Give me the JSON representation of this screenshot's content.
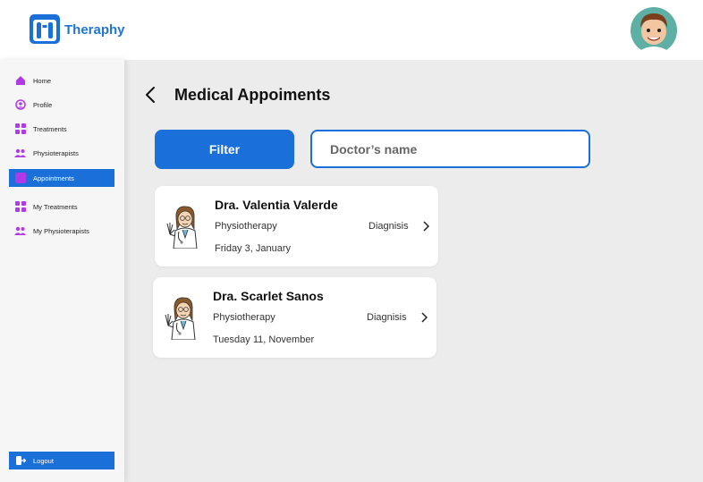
{
  "header": {
    "brand": "Theraphy"
  },
  "sidebar": {
    "items": [
      {
        "label": "Home",
        "icon": "home-icon"
      },
      {
        "label": "Profile",
        "icon": "profile-icon"
      },
      {
        "label": "Treatments",
        "icon": "grid-icon"
      },
      {
        "label": "Physioterapists",
        "icon": "people-icon"
      },
      {
        "label": "Appointments",
        "icon": "calendar-icon",
        "active": true
      },
      {
        "label": "My Treatments",
        "icon": "grid-icon"
      },
      {
        "label": "My Physioterapists",
        "icon": "people-icon"
      }
    ],
    "logout": "Logout"
  },
  "main": {
    "title": "Medical Appoiments",
    "filter_label": "Filter",
    "search_placeholder": "Doctor’s name",
    "appointments": [
      {
        "doctor": "Dra. Valentia Valerde",
        "specialty": "Physiotherapy",
        "date": "Friday 3, January",
        "action": "Diagnisis"
      },
      {
        "doctor": "Dra. Scarlet Sanos",
        "specialty": "Physiotherapy",
        "date": "Tuesday 11, November",
        "action": "Diagnisis"
      }
    ]
  },
  "colors": {
    "accent": "#1a6fd8",
    "brand_text": "#1f74d6",
    "nav_icon": "#b03ae6",
    "background": "#ececec"
  }
}
